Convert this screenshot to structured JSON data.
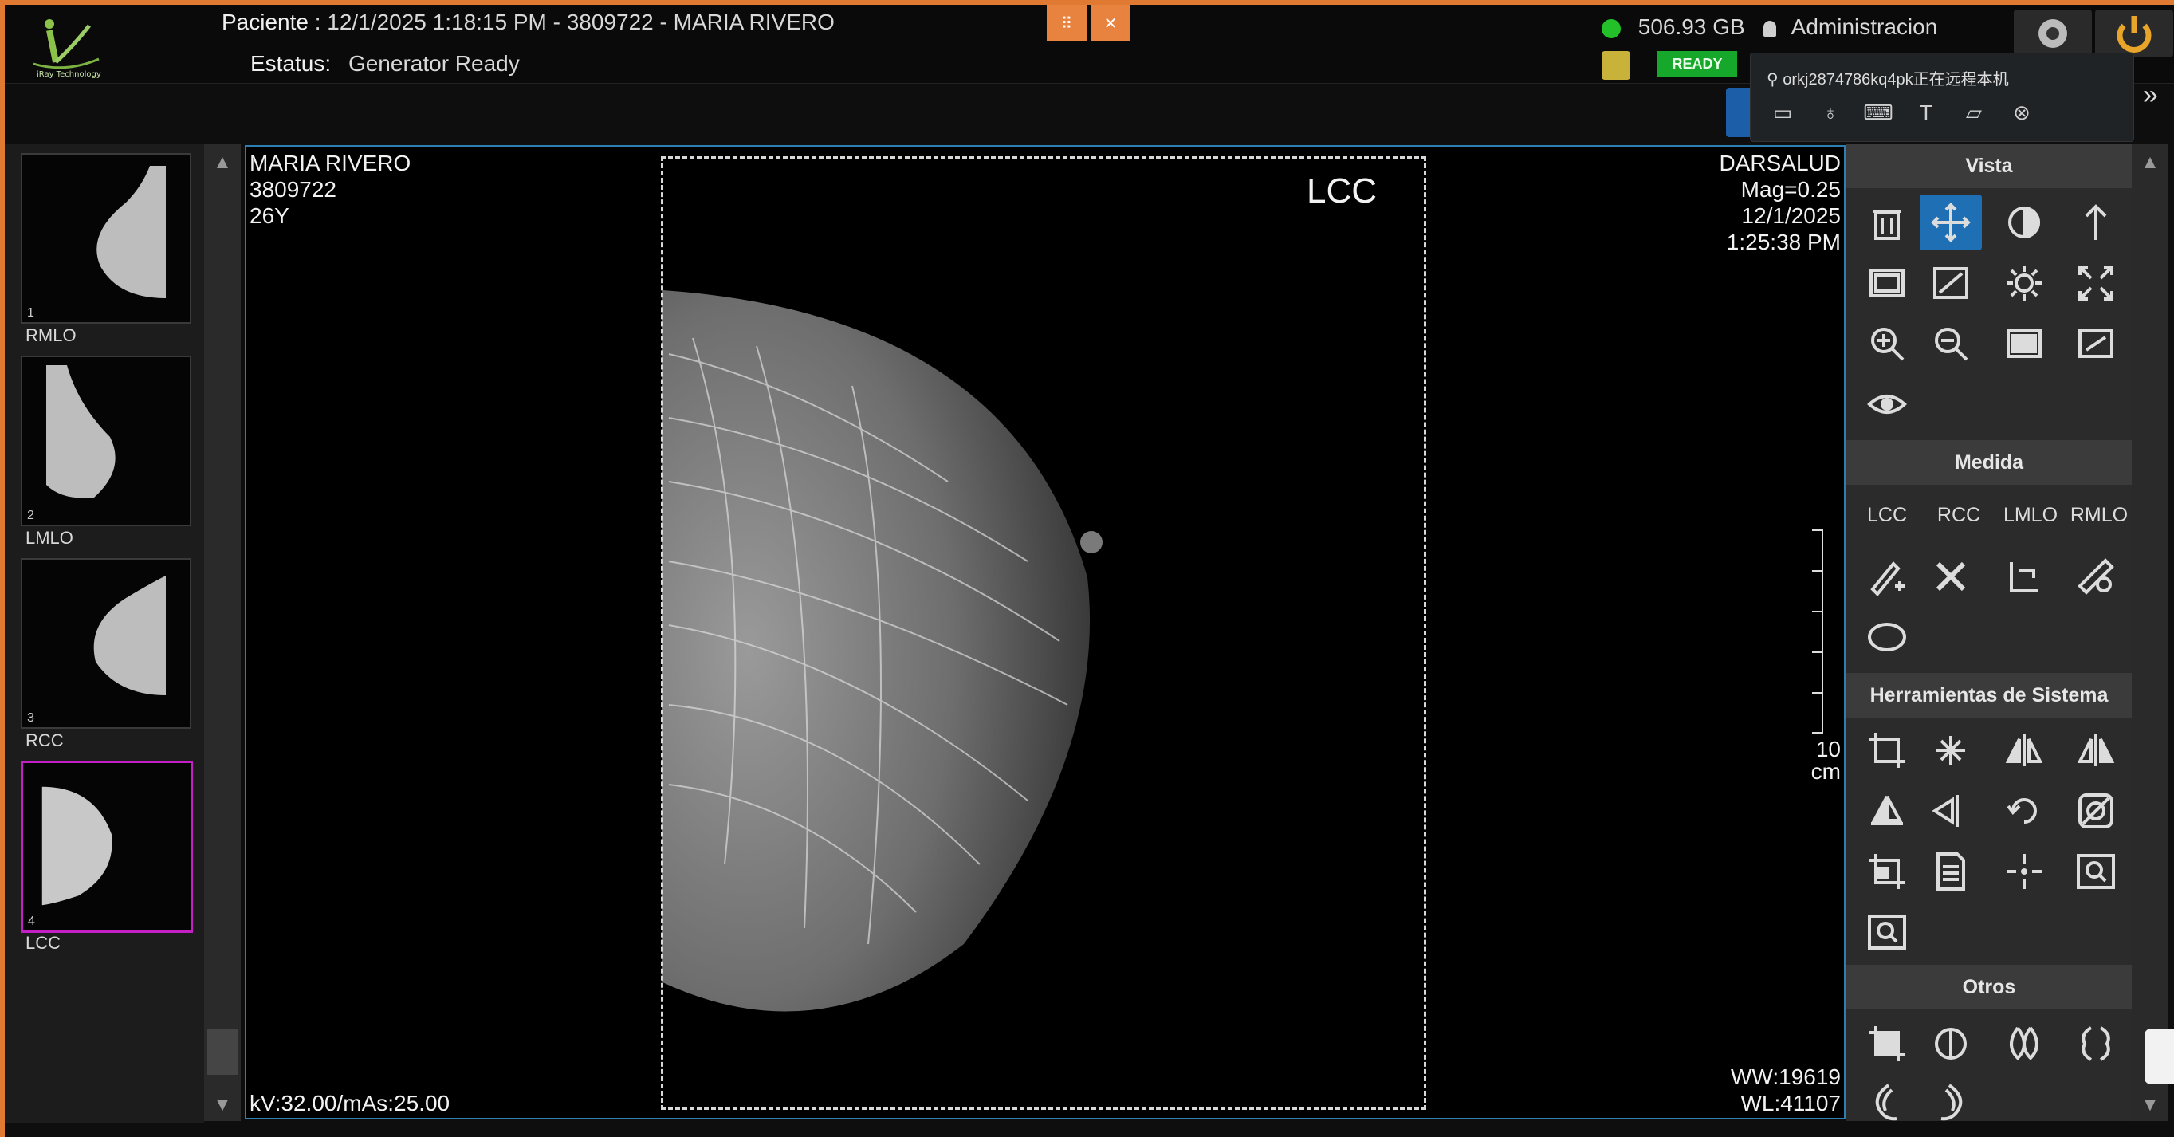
{
  "header": {
    "patient_label": "Paciente",
    "patient_value": ":  12/1/2025 1:18:15 PM - 3809722 - MARIA RIVERO",
    "status_label": "Estatus:",
    "status_value": "Generator Ready",
    "disk_space": "506.93 GB",
    "user": "Administracion",
    "ready_badge": "READY",
    "drag_icon": "⠿",
    "close_icon": "✕"
  },
  "remote": {
    "user_id": "orkj2874786kq4pk正在远程本机",
    "icons": [
      "chat-icon",
      "mic-icon",
      "keyboard-icon",
      "text-icon",
      "folder-icon",
      "close-icon"
    ]
  },
  "thumbnails": [
    {
      "num": "1",
      "label": "RMLO"
    },
    {
      "num": "2",
      "label": "LMLO"
    },
    {
      "num": "3",
      "label": "RCC"
    },
    {
      "num": "4",
      "label": "LCC"
    }
  ],
  "viewer": {
    "patient_name": "MARIA RIVERO",
    "patient_id": "3809722",
    "age": "26Y",
    "view_label": "LCC",
    "institution": "DARSALUD",
    "mag": "Mag=0.25",
    "date": "12/1/2025",
    "time": "1:25:38 PM",
    "scale_value": "10",
    "scale_unit": "cm",
    "exposure": "kV:32.00/mAs:25.00",
    "ww": "WW:19619",
    "wl": "WL:41107"
  },
  "tools": {
    "vista_title": "Vista",
    "medida_title": "Medida",
    "herramientas_title": "Herramientas de Sistema",
    "otros_title": "Otros",
    "view_labels": [
      "LCC",
      "RCC",
      "LMLO",
      "RMLO"
    ]
  },
  "colors": {
    "accent_orange": "#e07a33",
    "selection_magenta": "#c21fc4",
    "ready_green": "#16a82a",
    "viewer_border": "#2c7fb0",
    "selected_tool": "#1f6fb5"
  }
}
